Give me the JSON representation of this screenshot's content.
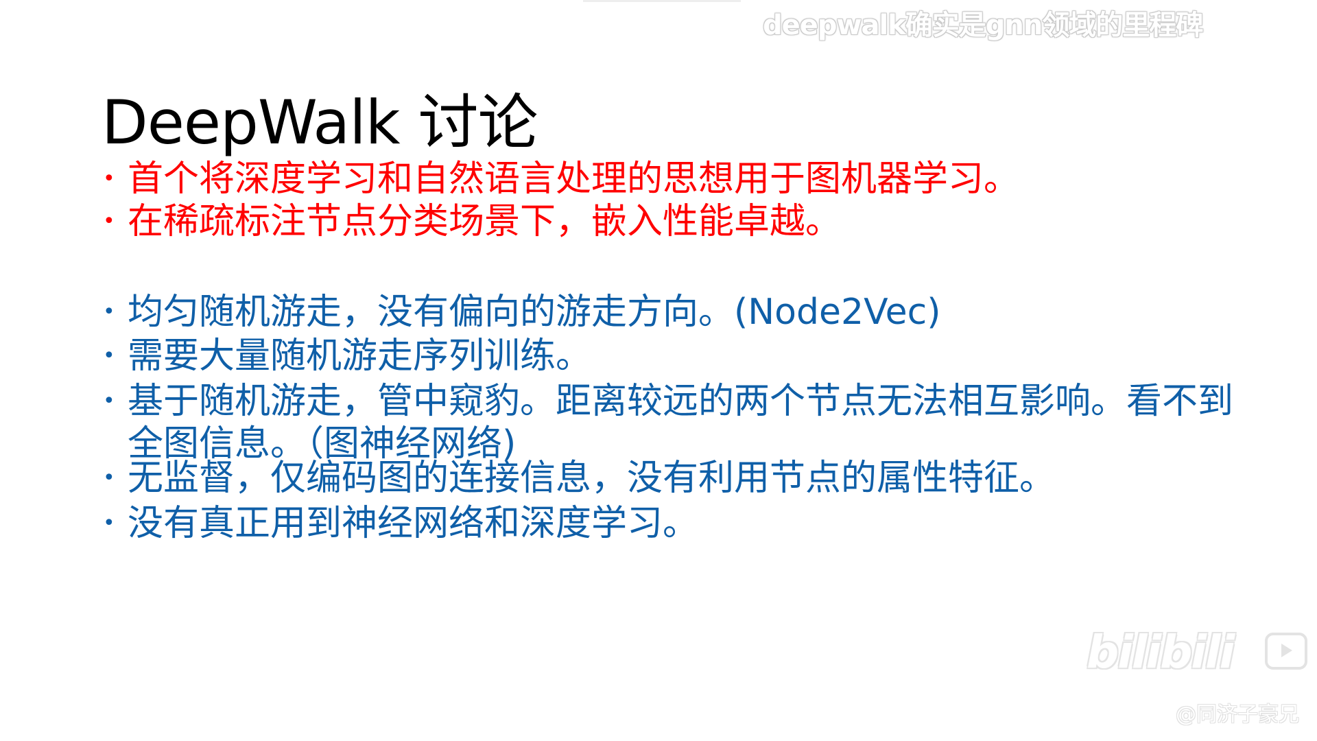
{
  "overlay": {
    "danmaku": "deepwalk确实是gnn领域的里程碑"
  },
  "slide": {
    "title": "DeepWalk 讨论",
    "bullet_glyph": "•",
    "red_bullets": [
      "首个将深度学习和自然语言处理的思想用于图机器学习。",
      "在稀疏标注节点分类场景下，嵌入性能卓越。"
    ],
    "blue_bullets": [
      "均匀随机游走，没有偏向的游走方向。(Node2Vec)",
      "需要大量随机游走序列训练。",
      "基于随机游走，管中窥豹。距离较远的两个节点无法相互影响。看不到全图信息。（图神经网络)",
      "无监督，仅编码图的连接信息，没有利用节点的属性特征。",
      "没有真正用到神经网络和深度学习。"
    ],
    "colors": {
      "red": "#ff0000",
      "blue": "#0f5fa8",
      "title": "#000000"
    }
  },
  "watermark": {
    "logo": "bilibili",
    "uploader": "@同济子豪兄",
    "icon": "tv-play-icon"
  }
}
